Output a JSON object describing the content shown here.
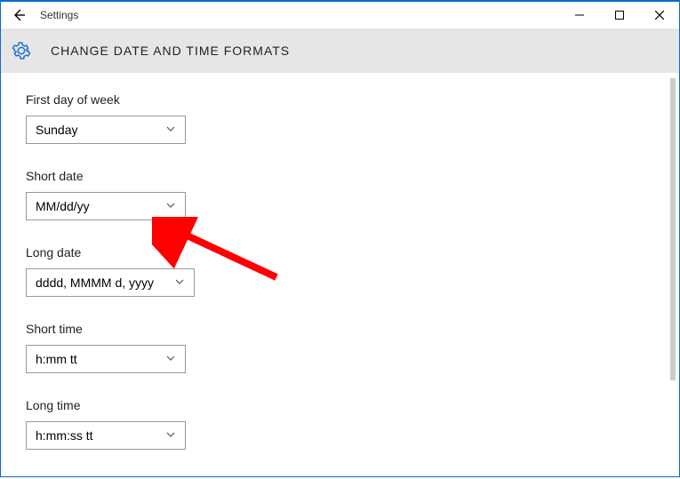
{
  "window": {
    "title": "Settings"
  },
  "header": {
    "title": "CHANGE DATE AND TIME FORMATS"
  },
  "fields": {
    "first_day_label": "First day of week",
    "first_day_value": "Sunday",
    "short_date_label": "Short date",
    "short_date_value": "MM/dd/yy",
    "long_date_label": "Long date",
    "long_date_value": "dddd, MMMM d, yyyy",
    "short_time_label": "Short time",
    "short_time_value": "h:mm tt",
    "long_time_label": "Long time",
    "long_time_value": "h:mm:ss tt"
  },
  "annotation": {
    "color": "#ff0000",
    "target": "short-date-dropdown"
  },
  "widths": {
    "first_day": 180,
    "short_date": 180,
    "long_date": 190,
    "short_time": 180,
    "long_time": 180
  }
}
